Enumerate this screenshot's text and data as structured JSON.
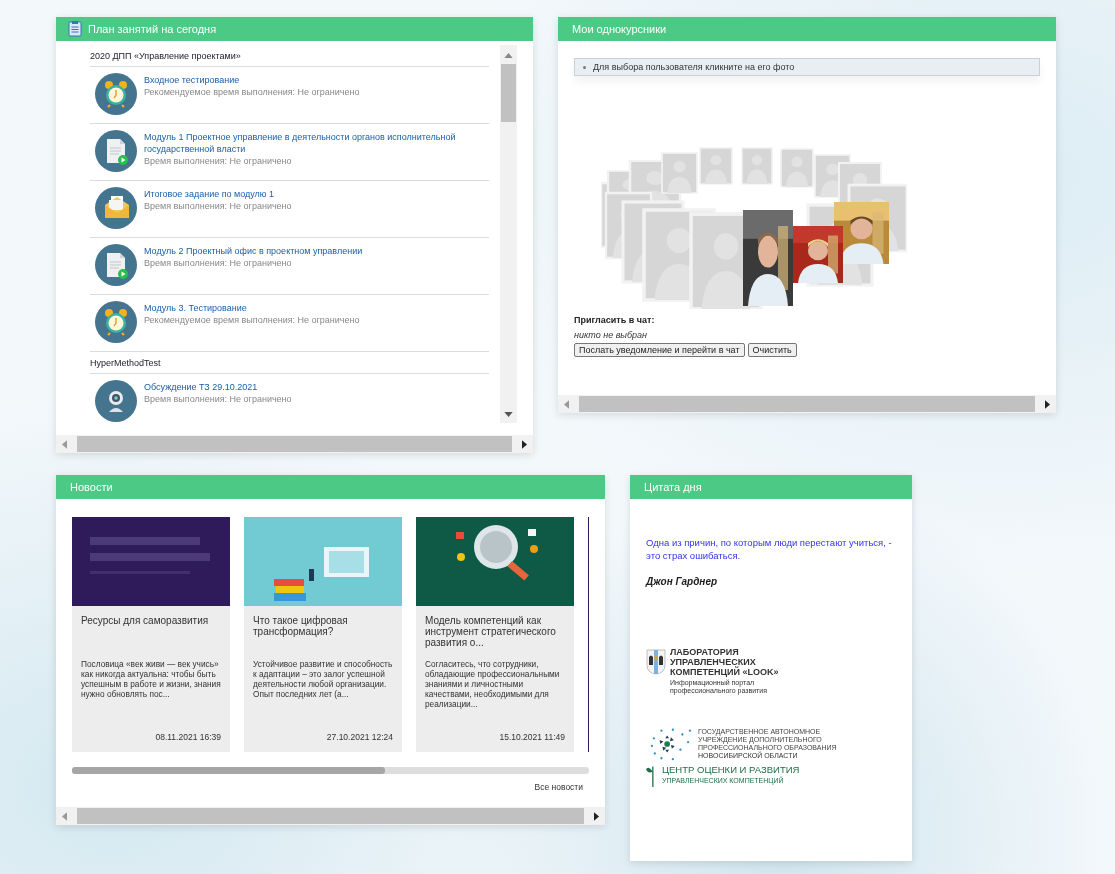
{
  "plan": {
    "title": "План занятий на сегодня",
    "groups": [
      {
        "title": "2020 ДПП «Управление проектами»",
        "items": [
          {
            "kind": "alarm",
            "title": "Входное тестирование",
            "note": "Рекомендуемое время выполнения: Не ограничено"
          },
          {
            "kind": "document",
            "title": "Модуль 1 Проектное управление в деятельности органов исполнительной государственной власти",
            "note": "Время выполнения: Не ограничено"
          },
          {
            "kind": "envelope",
            "title": "Итоговое задание по модулю 1",
            "note": "Время выполнения: Не ограничено"
          },
          {
            "kind": "document",
            "title": "Модуль 2 Проектный офис в проектном управлении",
            "note": "Время выполнения: Не ограничено"
          },
          {
            "kind": "alarm",
            "title": "Модуль 3. Тестирование",
            "note": "Рекомендуемое время выполнения: Не ограничено"
          }
        ]
      },
      {
        "title": "HyperMethodTest",
        "items": [
          {
            "kind": "webcam",
            "title": "Обсуждение ТЗ 29.10.2021",
            "note": "Время выполнения: Не ограничено"
          }
        ]
      }
    ]
  },
  "classmates": {
    "title": "Мои однокурсники",
    "hint": "Для выбора пользователя кликните на его фото",
    "photos": [
      {
        "kind": "placeholder"
      },
      {
        "kind": "placeholder"
      },
      {
        "kind": "placeholder"
      },
      {
        "kind": "placeholder"
      },
      {
        "kind": "placeholder"
      },
      {
        "kind": "placeholder"
      },
      {
        "kind": "placeholder"
      },
      {
        "kind": "placeholder"
      },
      {
        "kind": "placeholder"
      },
      {
        "kind": "placeholder"
      },
      {
        "kind": "placeholder"
      },
      {
        "kind": "placeholder"
      },
      {
        "kind": "placeholder"
      },
      {
        "kind": "placeholder"
      },
      {
        "kind": "placeholder"
      },
      {
        "kind": "picture"
      },
      {
        "kind": "picture"
      },
      {
        "kind": "picture"
      }
    ],
    "invite_label": "Пригласить в чат:",
    "invite_value": "никто не выбран",
    "buttons": [
      "Послать уведомление и перейти в чат",
      "Очистить"
    ]
  },
  "news": {
    "title": "Новости",
    "cards": [
      {
        "title": "Ресурсы для саморазвития",
        "text": "Пословица «век живи — век учись» как никогда актуальна: чтобы быть успешным в работе и жизни, знания нужно обновлять пос...",
        "date": "08.11.2021 16:39"
      },
      {
        "title": "Что такое цифровая трансформация?",
        "text": "Устойчивое развитие и способность к адаптации – это залог успешной деятельности любой организации. Опыт последних лет (а...",
        "date": "27.10.2021 12:24"
      },
      {
        "title": "Модель компетенций как инструмент стратегического развития о...",
        "text": "Согласитесь, что сотрудники, обладающие профессиональными знаниями и личностными качествами, необходимыми для реализации...",
        "date": "15.10.2021 11:49"
      }
    ],
    "all_link": "Все новости"
  },
  "quote": {
    "title": "Цитата дня",
    "text": "Одна из причин, по которым люди перестают учиться, - это страх ошибаться.",
    "author": "Джон Гарднер",
    "logo_1": {
      "lines": [
        "ЛАБОРАТОРИЯ",
        "УПРАВЛЕНЧЕСКИХ",
        "КОМПЕТЕНЦИЙ «LOOK»"
      ],
      "tagline": [
        "Информационный портал",
        "профессионального развития"
      ]
    },
    "logo_2": {
      "lines": [
        "ГОСУДАРСТВЕННОЕ АВТОНОМНОЕ",
        "УЧРЕЖДЕНИЕ ДОПОЛНИТЕЛЬНОГО",
        "ПРОФЕССИОНАЛЬНОГО ОБРАЗОВАНИЯ",
        "НОВОСИБИРСКОЙ ОБЛАСТИ"
      ],
      "name": "ЦЕНТР ОЦЕНКИ И РАЗВИТИЯ",
      "subname": "УПРАВЛЕНЧЕСКИХ КОМПЕТЕНЦИЙ"
    }
  }
}
